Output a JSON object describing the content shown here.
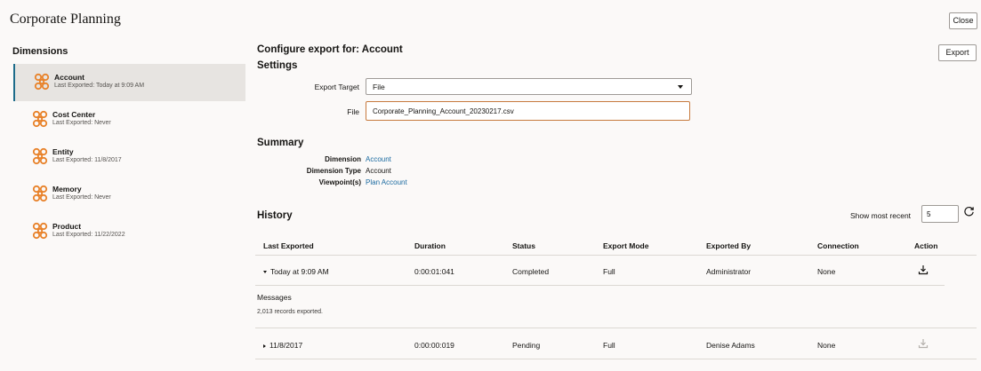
{
  "header": {
    "app_title": "Corporate Planning",
    "close_label": "Close"
  },
  "sidebar": {
    "heading": "Dimensions",
    "items": [
      {
        "name": "Account",
        "last_exported": "Last Exported: Today at 9:09 AM",
        "selected": true
      },
      {
        "name": "Cost Center",
        "last_exported": "Last Exported: Never",
        "selected": false
      },
      {
        "name": "Entity",
        "last_exported": "Last Exported: 11/8/2017",
        "selected": false
      },
      {
        "name": "Memory",
        "last_exported": "Last Exported: Never",
        "selected": false
      },
      {
        "name": "Product",
        "last_exported": "Last Exported: 11/22/2022",
        "selected": false
      }
    ]
  },
  "main": {
    "title": "Configure export for: Account",
    "export_label": "Export",
    "settings": {
      "heading": "Settings",
      "export_target_label": "Export Target",
      "export_target_value": "File",
      "file_label": "File",
      "file_value": "Corporate_Planning_Account_20230217.csv"
    },
    "summary": {
      "heading": "Summary",
      "dimension_label": "Dimension",
      "dimension_value": "Account",
      "dimension_type_label": "Dimension Type",
      "dimension_type_value": "Account",
      "viewpoints_label": "Viewpoint(s)",
      "viewpoints_value": "Plan Account"
    },
    "history": {
      "heading": "History",
      "show_recent_label": "Show most recent",
      "show_recent_value": "5",
      "columns": [
        "Last Exported",
        "Duration",
        "Status",
        "Export Mode",
        "Exported By",
        "Connection",
        "Action"
      ],
      "rows": [
        {
          "last_exported": "Today at 9:09 AM",
          "duration": "0:00:01:041",
          "status": "Completed",
          "mode": "Full",
          "by": "Administrator",
          "connection": "None",
          "expanded": true
        },
        {
          "last_exported": "11/8/2017",
          "duration": "0:00:00:019",
          "status": "Pending",
          "mode": "Full",
          "by": "Denise Adams",
          "connection": "None",
          "expanded": false
        }
      ],
      "messages_label": "Messages",
      "messages_text": "2,013 records exported."
    }
  },
  "colors": {
    "accent": "#1a6aa0",
    "icon_orange": "#e8822a",
    "input_focus": "#c77a3e",
    "selected_bg": "#e7e4e1"
  }
}
